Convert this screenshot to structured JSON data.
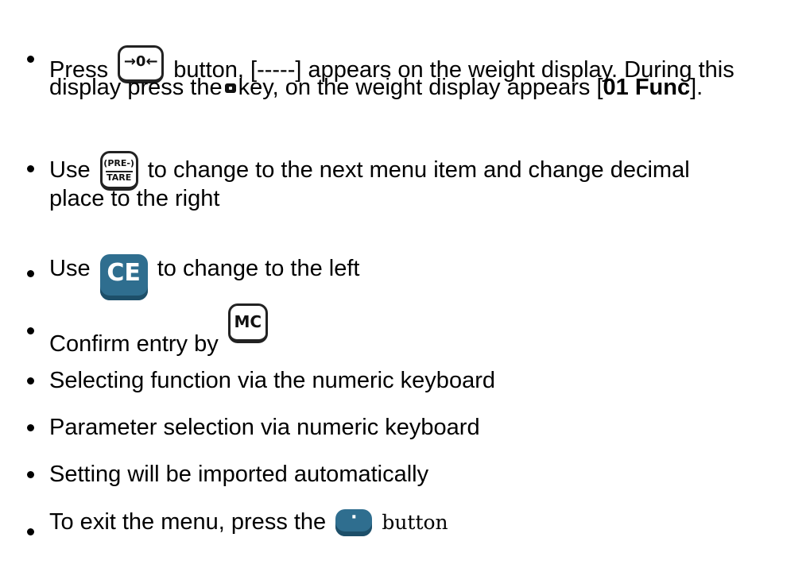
{
  "items": [
    {
      "pre": "Press",
      "key": "→0←",
      "post": "button, [-----] appears on the weight display. During this",
      "line2_pre": "display press the",
      "line2_post": "key, on the weight display appears [",
      "line2_bold": "01 Func",
      "line2_end": "]."
    },
    {
      "pre": "Use",
      "key_top": "(PRE-)",
      "key_bottom": "TARE",
      "post": "to change to the next menu item and change decimal",
      "line2": "place to the right"
    },
    {
      "pre": "Use",
      "key": "CE",
      "post": "to change to the left"
    },
    {
      "pre": "Confirm entry by",
      "key": "MC"
    },
    {
      "text": "Selecting function via the numeric keyboard"
    },
    {
      "text": "Parameter selection via numeric keyboard"
    },
    {
      "text": "Setting will be imported automatically"
    },
    {
      "pre": "To exit the menu, press the",
      "key": "·",
      "post": "button"
    }
  ],
  "colors": {
    "filled_key": "#2f6e8f",
    "text": "#000000"
  },
  "icons": [
    "zero-key-icon",
    "small-square-key-icon",
    "pre-tare-key-icon",
    "ce-key-icon",
    "mc-key-icon",
    "dot-key-icon"
  ]
}
